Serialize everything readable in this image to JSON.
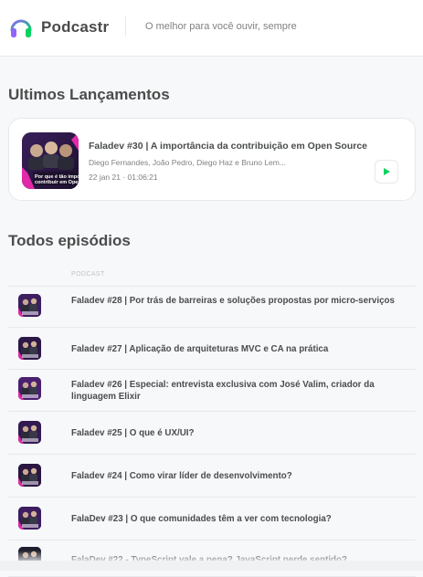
{
  "header": {
    "app_name": "Podcastr",
    "tagline": "O melhor para você ouvir, sempre",
    "logo_icon": "headphones-icon",
    "accent_color": "#8257e5"
  },
  "latest": {
    "section_title": "Ultimos Lançamentos",
    "episodes": [
      {
        "title": "Faladev #30 | A importância da contribuição em Open Source",
        "members": "Diego Fernandes, João Pedro, Diego Haz e Bruno Lem...",
        "meta": "22 jan 21 · 01:06:21",
        "thumb_caption": "Por que é tão impo contribuir em Open S",
        "play_color": "#04d361"
      }
    ]
  },
  "all": {
    "section_title": "Todos episódios",
    "column_header": "PODCAST",
    "episodes": [
      {
        "title": "Faladev #28 | Por trás de barreiras e soluções propostas por micro-serviços"
      },
      {
        "title": "Faladev #27 | Aplicação de arquiteturas MVC e CA na prática"
      },
      {
        "title": "Faladev #26 | Especial: entrevista exclusiva com José Valim, criador da linguagem Elixir"
      },
      {
        "title": "Faladev #25 | O que é UX/UI?"
      },
      {
        "title": "Faladev #24 | Como virar líder de desenvolvimento?"
      },
      {
        "title": "FalaDev #23 | O que comunidades têm a ver com tecnologia?"
      },
      {
        "title": "FalaDev #22 - TypeScript vale a pena? JavaScript perde sentido?"
      }
    ]
  }
}
